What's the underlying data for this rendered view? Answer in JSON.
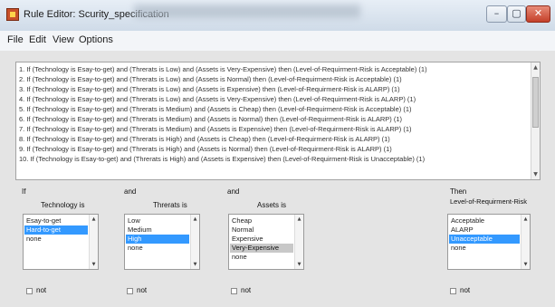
{
  "window": {
    "title": "Rule Editor: Scurity_specification",
    "minimize_glyph": "–",
    "maximize_glyph": "▢",
    "close_glyph": "✕"
  },
  "menu": [
    "File",
    "Edit",
    "View",
    "Options"
  ],
  "rules": [
    "1. If (Technology is Esay-to-get) and (Threrats is Low) and (Assets is Very-Expensive) then (Level-of-Requirment-Risk is Acceptable) (1)",
    "2. If (Technology is Esay-to-get) and (Threrats is Low) and (Assets is Normal) then (Level-of-Requirment-Risk is Acceptable) (1)",
    "3. If (Technology is Esay-to-get) and (Threrats is Low) and (Assets is Expensive) then (Level-of-Requirment-Risk is ALARP) (1)",
    "4. If (Technology is Esay-to-get) and (Threrats is Low) and (Assets is Very-Expensive) then (Level-of-Requirment-Risk is ALARP) (1)",
    "5. If (Technology is Esay-to-get) and (Threrats is Medium) and (Assets is Cheap) then (Level-of-Requirment-Risk is Acceptable) (1)",
    "6. If (Technology is Esay-to-get) and (Threrats is Medium) and (Assets is Normal) then (Level-of-Requirment-Risk is ALARP) (1)",
    "7. If (Technology is Esay-to-get) and (Threrats is Medium) and (Assets is Expensive) then (Level-of-Requirment-Risk is ALARP) (1)",
    "8. If (Technology is Esay-to-get) and (Threrats is High) and (Assets is Cheap) then (Level-of-Requirment-Risk is ALARP) (1)",
    "9. If (Technology is Esay-to-get) and (Threrats is High) and (Assets is Normal) then (Level-of-Requirment-Risk is ALARP) (1)",
    "10. If (Technology is Esay-to-get) and (Threrats is High) and (Assets is Expensive) then (Level-of-Requirment-Risk is Unacceptable) (1)"
  ],
  "antecedents": [
    {
      "connector": "If",
      "variable": "Technology is",
      "options": [
        "Esay-to-get",
        "Hard-to-get",
        "none"
      ],
      "selected_index": 1,
      "not_label": "not"
    },
    {
      "connector": "and",
      "variable": "Threrats is",
      "options": [
        "Low",
        "Medium",
        "High",
        "none"
      ],
      "selected_index": 2,
      "not_label": "not"
    },
    {
      "connector": "and",
      "variable": "Assets is",
      "options": [
        "Cheap",
        "Normal",
        "Expensive",
        "Very-Expensive",
        "none"
      ],
      "selected_index": 3,
      "not_label": "not"
    }
  ],
  "consequent": {
    "connector": "Then",
    "variable": "Level-of-Requirment-Risk",
    "options": [
      "Acceptable",
      "ALARP",
      "Unacceptable",
      "none"
    ],
    "selected_index": 2,
    "not_label": "not"
  },
  "colors": {
    "selection": "#3399ff",
    "inactive_selection": "#c8c8c8"
  }
}
